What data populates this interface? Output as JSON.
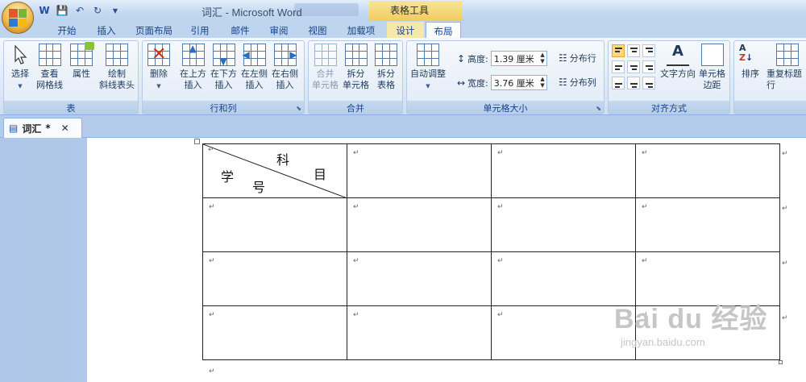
{
  "title_bar": {
    "title": "词汇 - Microsoft Word",
    "contextual_tab_group": "表格工具"
  },
  "tabs": [
    {
      "label": "开始"
    },
    {
      "label": "插入"
    },
    {
      "label": "页面布局"
    },
    {
      "label": "引用"
    },
    {
      "label": "邮件"
    },
    {
      "label": "审阅"
    },
    {
      "label": "视图"
    },
    {
      "label": "加载项"
    },
    {
      "label": "设计"
    },
    {
      "label": "布局"
    }
  ],
  "active_tab": "布局",
  "ribbon": {
    "table_group": {
      "label": "表",
      "select": "选择",
      "view_gridlines_1": "查看",
      "view_gridlines_2": "网格线",
      "properties": "属性",
      "draw_1": "绘制",
      "draw_2": "斜线表头"
    },
    "rows_cols_group": {
      "label": "行和列",
      "delete": "删除",
      "insert_above_1": "在上方",
      "insert_above_2": "插入",
      "insert_below_1": "在下方",
      "insert_below_2": "插入",
      "insert_left_1": "在左侧",
      "insert_left_2": "插入",
      "insert_right_1": "在右侧",
      "insert_right_2": "插入"
    },
    "merge_group": {
      "label": "合并",
      "merge_1": "合并",
      "merge_2": "单元格",
      "split_cells_1": "拆分",
      "split_cells_2": "单元格",
      "split_table_1": "拆分",
      "split_table_2": "表格"
    },
    "cell_size_group": {
      "label": "单元格大小",
      "autofit": "自动调整",
      "height_label": "高度:",
      "height_value": "1.39 厘米",
      "width_label": "宽度:",
      "width_value": "3.76 厘米",
      "distribute_rows": "分布行",
      "distribute_cols": "分布列"
    },
    "alignment_group": {
      "label": "对齐方式",
      "text_direction": "文字方向",
      "cell_margins_1": "单元格",
      "cell_margins_2": "边距"
    },
    "data_group": {
      "sort": "排序",
      "repeat_header": "重复标题行"
    }
  },
  "document_tab": {
    "name": "词汇",
    "modified_marker": "*"
  },
  "table": {
    "header_cell": {
      "top_right_1": "科",
      "top_right_2": "目",
      "bottom_left_1": "学",
      "bottom_left_2": "号"
    },
    "rows": 4,
    "cols": 4,
    "paragraph_mark": "↵"
  },
  "watermark": {
    "brand": "Bai du 经验",
    "url": "jingyan.baidu.com"
  }
}
